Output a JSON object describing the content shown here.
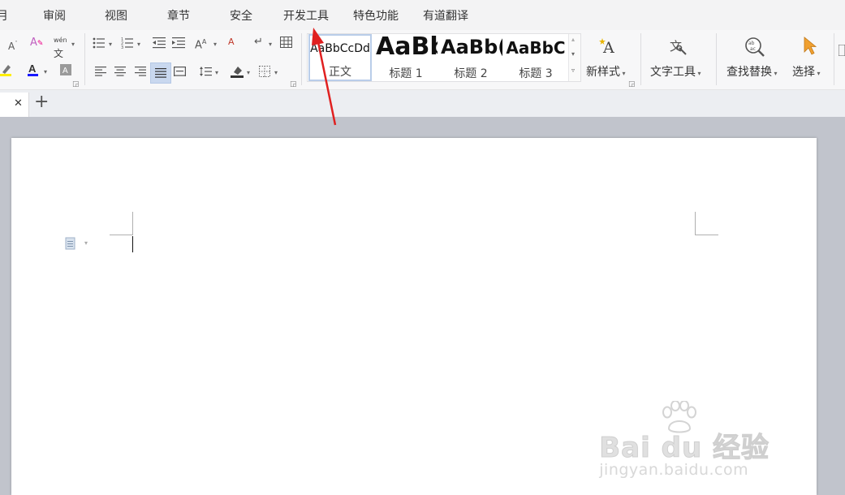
{
  "menu": {
    "items": [
      "月",
      "审阅",
      "视图",
      "章节",
      "安全",
      "开发工具",
      "特色功能",
      "有道翻译"
    ]
  },
  "ribbon": {
    "styles": [
      {
        "sample": "AaBbCcDd",
        "label": "正文"
      },
      {
        "sample": "AaBb",
        "label": "标题 1"
      },
      {
        "sample": "AaBb(",
        "label": "标题 2"
      },
      {
        "sample": "AaBbC",
        "label": "标题 3"
      }
    ],
    "new_style_label": "新样式",
    "text_tools_label": "文字工具",
    "find_replace_label": "查找替换",
    "select_label": "选择",
    "wen_label": "wén",
    "wen_char": "文"
  },
  "colors": {
    "accent_arrow": "#e02020",
    "font_color_bar": "#1a1aff",
    "highlight_bar": "#ffee00"
  },
  "tabbar": {
    "new_tab": "+"
  },
  "watermark": {
    "brand": "Bai du 经验",
    "url": "jingyan.baidu.com"
  }
}
